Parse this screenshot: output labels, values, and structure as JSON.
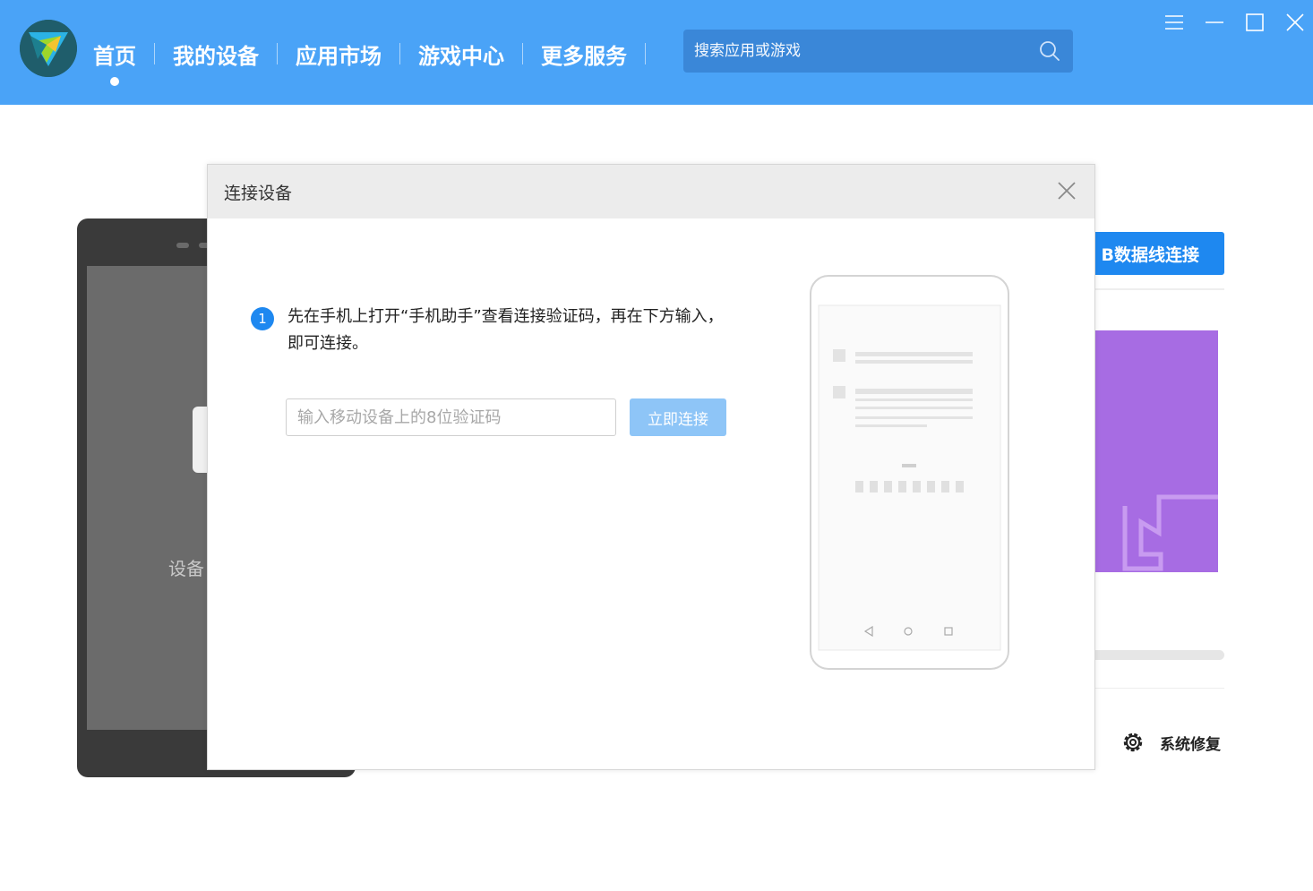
{
  "nav": {
    "items": [
      {
        "label": "首页",
        "active": true
      },
      {
        "label": "我的设备"
      },
      {
        "label": "应用市场"
      },
      {
        "label": "游戏中心"
      },
      {
        "label": "更多服务"
      }
    ]
  },
  "search": {
    "placeholder": "搜索应用或游戏",
    "icon": "search-icon"
  },
  "window_controls": [
    "menu-icon",
    "minimize-icon",
    "maximize-icon",
    "close-icon"
  ],
  "background_page": {
    "device_text": "设备",
    "usb_button": "B数据线连接",
    "repair_label": "系统修复",
    "promo_color": "#a76ce3"
  },
  "dialog": {
    "title": "连接设备",
    "step_number": "1",
    "instruction": "先在手机上打开“手机助手”查看连接验证码，再在下方输入，即可连接。",
    "code_input": {
      "placeholder": "输入移动设备上的8位验证码",
      "value": ""
    },
    "connect_button": "立即连接"
  },
  "colors": {
    "topbar": "#4aa3f7",
    "search_bg": "#3a87d8",
    "accent": "#1e88f0",
    "connect_button_disabled": "#8ec5f7"
  }
}
